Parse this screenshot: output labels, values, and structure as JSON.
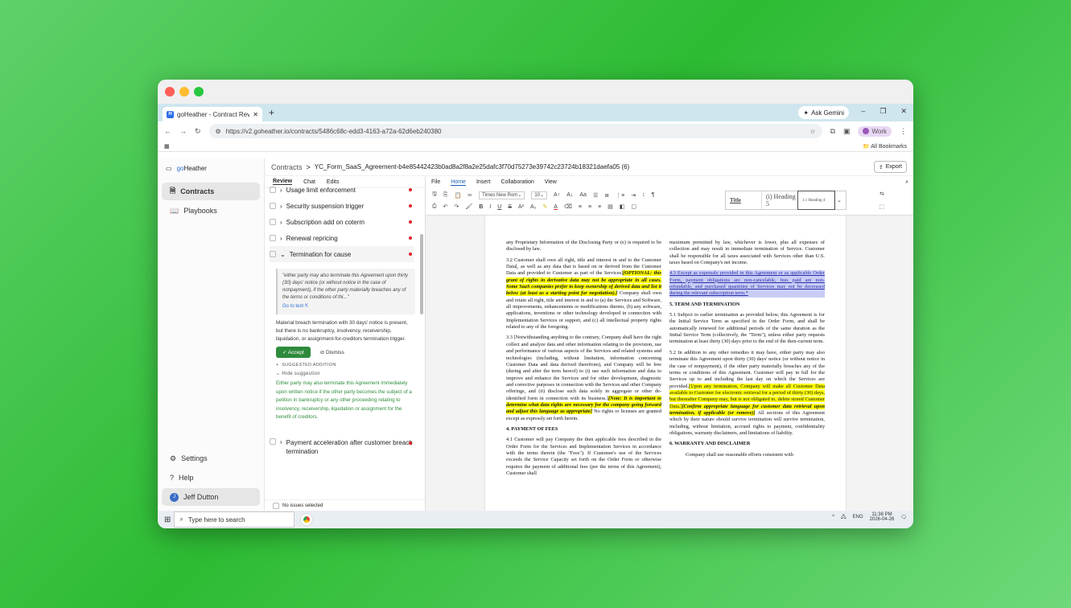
{
  "colors": {
    "accent": "#2e8b3c",
    "link": "#2f6fd6",
    "danger": "#d9242e",
    "highlight": "#ffff00"
  },
  "browser": {
    "tab_title": "goHeather - Contract Review",
    "new_tab": "+",
    "gemini": "Ask Gemini",
    "url": "https://v2.goheather.io/contracts/5486c68c-edd3-4163-a72a-62d6eb240380",
    "profile": "Work",
    "bookmarks": "All Bookmarks"
  },
  "sidebar": {
    "brand_prefix": "go",
    "brand_suffix": "Heather",
    "items": [
      {
        "label": "Contracts"
      },
      {
        "label": "Playbooks"
      }
    ],
    "settings": "Settings",
    "help": "Help",
    "user": "Jeff Dutton",
    "user_initial": "J"
  },
  "header": {
    "crumb_root": "Contracts",
    "crumb_sep": ">",
    "file": "YC_Form_SaaS_Agreement-b4e85442423b0ad8a2f8a2e25dafc3f70d75273e39742c23724b18321daefa05 (6)",
    "export": "Export"
  },
  "review": {
    "tabs": [
      "Review",
      "Chat",
      "Edits"
    ],
    "items": [
      {
        "label": "Usage limit enforcement"
      },
      {
        "label": "Security suspension trigger"
      },
      {
        "label": "Subscription add on coterm"
      },
      {
        "label": "Renewal repricing"
      },
      {
        "label": "Termination for cause"
      }
    ],
    "quote": "\"either party may also terminate this Agreement upon thirty (30) days' notice (or without notice in the case of nonpayment), if the other party materially breaches any of the terms or conditions of thi...\"",
    "goto": "Go to text",
    "finding": "Material breach termination with 30 days' notice is present, but there is no bankruptcy, insolvency, receivership, liquidation, or assignment-for-creditors termination trigger.",
    "accept": "Accept",
    "dismiss": "Dismiss",
    "suggested": "SUGGESTED ADDITION",
    "hide": "Hide suggestion",
    "suggestion": "Either party may also terminate this Agreement immediately upon written notice if the other party becomes the subject of a petition in bankruptcy or any other proceeding relating to insolvency, receivership, liquidation or assignment for the benefit of creditors.",
    "next_item": "Payment acceleration after customer breach termination",
    "status": "No issues selected"
  },
  "editor": {
    "menu": [
      "File",
      "Home",
      "Insert",
      "Collaboration",
      "View"
    ],
    "font": "Times New Rom",
    "size": "10",
    "styles": [
      "Title",
      "(i) Heading 5",
      "1.1 Heading 4"
    ]
  },
  "doc": {
    "l1": "any Proprietary Information of the Disclosing Party or (e) is required to be disclosed by law.",
    "l2a": "3.2        Customer shall own all right, title and interest in and to the Customer Data[, as well as any data that is based on or derived from the Customer Data and provided to Customer as part of the Services]",
    "l2b": "[OPTIONAL: this grant of rights in derivative data may not be appropriate in all cases. Some SaaS companies prefer to keep ownership of derived data and list it below (at least as a starting point for negotiation).]",
    "l2c": " Company shall own and retain all right, title and interest in and to (a) the Services and Software, all improvements, enhancements or modifications thereto, (b) any software, applications, inventions or other technology developed in connection with Implementation Services or support, and (c) all intellectual property rights related to any of the foregoing.",
    "l3a": "3.3        [Notwithstanding anything to the contrary, Company shall have the right collect and analyze data and other information relating to the provision, use and performance of various aspects of the Services and related systems and technologies (including, without limitation, information concerning Customer Data and data derived therefrom), and Company will be free (during and after the term hereof) to (i) use such information and data to improve and enhance the Services and for other development, diagnostic and corrective purposes in connection with the Services and other Company offerings, and (ii) disclose such data solely in aggregate or other de-identified form in connection with its business.]",
    "l3b": "[Note: It is important to determine what data rights are necessary for the company going forward and adjust this language as appropriate]",
    "l3c": " No rights or licenses are granted except as expressly set forth herein.",
    "h4": "4.        PAYMENT OF FEES",
    "l4": "4.1        Customer will pay Company the then applicable fees described in the Order Form for the Services and Implementation Services in accordance with the terms therein (the \"Fees\"). If Customer's use of the Services exceeds the Service Capacity set forth on the Order Form or otherwise requires the payment of additional fees (per the terms of this Agreement), Customer shall",
    "r1": "maximum permitted by law, whichever is lower, plus all expenses of collection and may result in immediate termination of Service. Customer shall be responsible for all taxes associated with Services other than U.S. taxes based on Company's net income.",
    "r2": "4.3        Except as expressly provided in this Agreement or as applicable Order Form, payment obligations are non-cancelable, fees paid are non-refundable, and purchased quantities of Services may not be decreased during the relevant subscription term.*",
    "h5": "5.        TERM AND TERMINATION",
    "r3": "5.1        Subject to earlier termination as provided below, this Agreement is for the Initial Service Term as specified in the Order Form, and shall be automatically renewed for additional periods of the same duration as the Initial Service Term (collectively, the \"Term\"), unless either party requests termination at least thirty (30) days prior to the end of the then-current term.",
    "r4a": "5.2        In addition to any other remedies it may have, either party may also terminate this Agreement upon thirty (30) days' notice (or without notice in the case of nonpayment), if the other party materially breaches any of the terms or conditions of this Agreement. Customer will pay in full for the Services up to and including the last day on which the Services are provided.",
    "r4b": "[Upon any termination, Company will make all Customer Data available to Customer for electronic retrieval for a period of thirty (30) days, but thereafter Company may, but is not obligated to, delete stored Customer Data.]",
    "r4c": "[Confirm appropriate language for customer data retrieval upon termination, if applicable (or remove)]",
    "r4d": " All sections of this Agreement which by their nature should survive termination will survive termination, including, without limitation, accrued rights to payment, confidentiality obligations, warranty disclaimers, and limitations of liability.",
    "h6": "6.        WARRANTY AND DISCLAIMER",
    "r5": "Company shall use reasonable efforts consistent with"
  },
  "taskbar": {
    "search": "Type here to search",
    "lang": "ENG",
    "time": "11:38 PM",
    "date": "2026-04-26"
  }
}
